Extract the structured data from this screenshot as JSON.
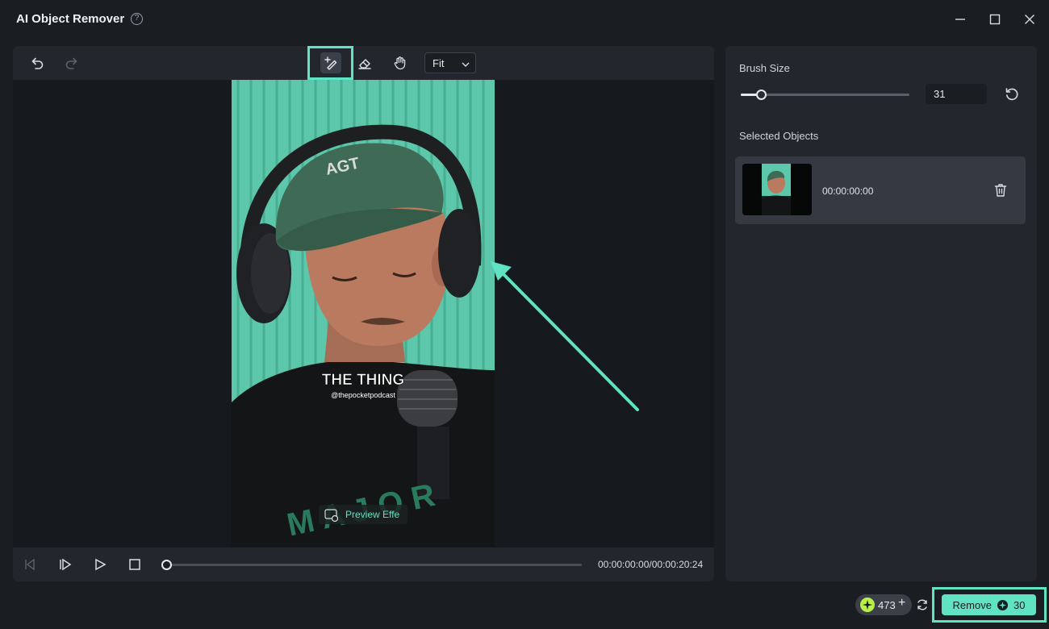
{
  "window": {
    "title": "AI Object Remover",
    "help_icon": "?",
    "controls": [
      "minimize-icon",
      "maximize-icon",
      "close-icon"
    ]
  },
  "toolbar": {
    "tools": [
      "undo-icon",
      "redo-icon",
      "smart-brush-icon",
      "eraser-icon",
      "hand-icon"
    ],
    "zoom_value": "Fit"
  },
  "video": {
    "caption_title": "THE THING",
    "caption_handle": "@thepocketpodcast",
    "cap_text": "AGT",
    "preview_label": "Preview Effe"
  },
  "playback": {
    "timecode": "00:00:00:00/00:00:20:24",
    "progress": 0
  },
  "side_panel": {
    "brush_size_label": "Brush Size",
    "brush_size_value": "31",
    "brush_size_fraction": 0.12,
    "selected_objects_label": "Selected Objects",
    "objects": [
      {
        "time": "00:00:00:00"
      }
    ]
  },
  "footer": {
    "credits": "473",
    "remove_label": "Remove",
    "remove_cost": "30"
  },
  "colors": {
    "accent": "#5fe3c2",
    "background": "#1a1d22",
    "panel": "#23272d"
  }
}
